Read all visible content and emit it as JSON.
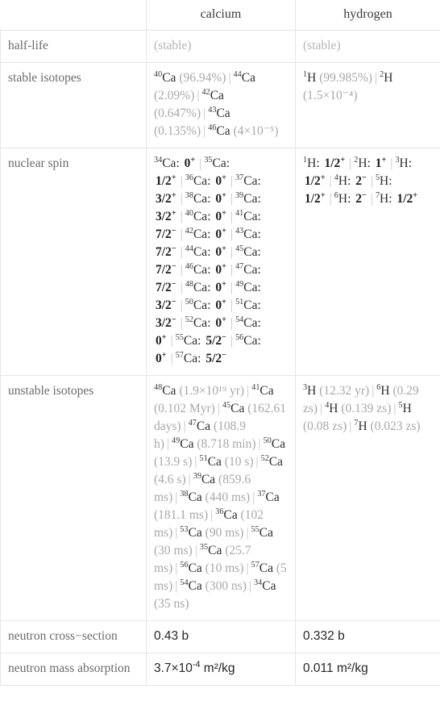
{
  "header": {
    "corner": "",
    "columns": [
      "calcium",
      "hydrogen"
    ]
  },
  "rows": {
    "half_life": {
      "label": "half-life",
      "calcium": "(stable)",
      "hydrogen": "(stable)"
    },
    "stable_isotopes": {
      "label": "stable isotopes",
      "calcium": "40Ca (96.94%) | 44Ca (2.09%) | 42Ca (0.647%) | 43Ca (0.135%) | 46Ca (4×10^-5)",
      "hydrogen": "1H (99.985%) | 2H (1.5×10^-4)",
      "calcium_items": [
        {
          "mass": "40",
          "symbol": "Ca",
          "value": "(96.94%)"
        },
        {
          "mass": "44",
          "symbol": "Ca",
          "value": "(2.09%)"
        },
        {
          "mass": "42",
          "symbol": "Ca",
          "value": "(0.647%)"
        },
        {
          "mass": "43",
          "symbol": "Ca",
          "value": "(0.135%)"
        },
        {
          "mass": "46",
          "symbol": "Ca",
          "value": "(4×10⁻⁵)"
        }
      ],
      "hydrogen_items": [
        {
          "mass": "1",
          "symbol": "H",
          "value": "(99.985%)"
        },
        {
          "mass": "2",
          "symbol": "H",
          "value": "(1.5×10⁻⁴)"
        }
      ]
    },
    "nuclear_spin": {
      "label": "nuclear spin",
      "calcium_items": [
        {
          "mass": "34",
          "symbol": "Ca",
          "spin": "0+"
        },
        {
          "mass": "35",
          "symbol": "Ca",
          "spin": "1/2+"
        },
        {
          "mass": "36",
          "symbol": "Ca",
          "spin": "0+"
        },
        {
          "mass": "37",
          "symbol": "Ca",
          "spin": "3/2+"
        },
        {
          "mass": "38",
          "symbol": "Ca",
          "spin": "0+"
        },
        {
          "mass": "39",
          "symbol": "Ca",
          "spin": "3/2+"
        },
        {
          "mass": "40",
          "symbol": "Ca",
          "spin": "0+"
        },
        {
          "mass": "41",
          "symbol": "Ca",
          "spin": "7/2-"
        },
        {
          "mass": "42",
          "symbol": "Ca",
          "spin": "0+"
        },
        {
          "mass": "43",
          "symbol": "Ca",
          "spin": "7/2-"
        },
        {
          "mass": "44",
          "symbol": "Ca",
          "spin": "0+"
        },
        {
          "mass": "45",
          "symbol": "Ca",
          "spin": "7/2-"
        },
        {
          "mass": "46",
          "symbol": "Ca",
          "spin": "0+"
        },
        {
          "mass": "47",
          "symbol": "Ca",
          "spin": "7/2-"
        },
        {
          "mass": "48",
          "symbol": "Ca",
          "spin": "0+"
        },
        {
          "mass": "49",
          "symbol": "Ca",
          "spin": "3/2-"
        },
        {
          "mass": "50",
          "symbol": "Ca",
          "spin": "0+"
        },
        {
          "mass": "51",
          "symbol": "Ca",
          "spin": "3/2-"
        },
        {
          "mass": "52",
          "symbol": "Ca",
          "spin": "0+"
        },
        {
          "mass": "54",
          "symbol": "Ca",
          "spin": "0+"
        },
        {
          "mass": "55",
          "symbol": "Ca",
          "spin": "5/2-"
        },
        {
          "mass": "56",
          "symbol": "Ca",
          "spin": "0+"
        },
        {
          "mass": "57",
          "symbol": "Ca",
          "spin": "5/2-"
        }
      ],
      "hydrogen_items": [
        {
          "mass": "1",
          "symbol": "H",
          "spin": "1/2+"
        },
        {
          "mass": "2",
          "symbol": "H",
          "spin": "1+"
        },
        {
          "mass": "3",
          "symbol": "H",
          "spin": "1/2+"
        },
        {
          "mass": "4",
          "symbol": "H",
          "spin": "2-"
        },
        {
          "mass": "5",
          "symbol": "H",
          "spin": "1/2+"
        },
        {
          "mass": "6",
          "symbol": "H",
          "spin": "2-"
        },
        {
          "mass": "7",
          "symbol": "H",
          "spin": "1/2+"
        }
      ]
    },
    "unstable_isotopes": {
      "label": "unstable isotopes",
      "calcium_items": [
        {
          "mass": "48",
          "symbol": "Ca",
          "value": "(1.9×10¹⁹ yr)"
        },
        {
          "mass": "41",
          "symbol": "Ca",
          "value": "(0.102 Myr)"
        },
        {
          "mass": "45",
          "symbol": "Ca",
          "value": "(162.61 days)"
        },
        {
          "mass": "47",
          "symbol": "Ca",
          "value": "(108.9 h)"
        },
        {
          "mass": "49",
          "symbol": "Ca",
          "value": "(8.718 min)"
        },
        {
          "mass": "50",
          "symbol": "Ca",
          "value": "(13.9 s)"
        },
        {
          "mass": "51",
          "symbol": "Ca",
          "value": "(10 s)"
        },
        {
          "mass": "52",
          "symbol": "Ca",
          "value": "(4.6 s)"
        },
        {
          "mass": "39",
          "symbol": "Ca",
          "value": "(859.6 ms)"
        },
        {
          "mass": "38",
          "symbol": "Ca",
          "value": "(440 ms)"
        },
        {
          "mass": "37",
          "symbol": "Ca",
          "value": "(181.1 ms)"
        },
        {
          "mass": "36",
          "symbol": "Ca",
          "value": "(102 ms)"
        },
        {
          "mass": "53",
          "symbol": "Ca",
          "value": "(90 ms)"
        },
        {
          "mass": "55",
          "symbol": "Ca",
          "value": "(30 ms)"
        },
        {
          "mass": "35",
          "symbol": "Ca",
          "value": "(25.7 ms)"
        },
        {
          "mass": "56",
          "symbol": "Ca",
          "value": "(10 ms)"
        },
        {
          "mass": "57",
          "symbol": "Ca",
          "value": "(5 ms)"
        },
        {
          "mass": "54",
          "symbol": "Ca",
          "value": "(300 ns)"
        },
        {
          "mass": "34",
          "symbol": "Ca",
          "value": "(35 ns)"
        }
      ],
      "hydrogen_items": [
        {
          "mass": "3",
          "symbol": "H",
          "value": "(12.32 yr)"
        },
        {
          "mass": "6",
          "symbol": "H",
          "value": "(0.29 zs)"
        },
        {
          "mass": "4",
          "symbol": "H",
          "value": "(0.139 zs)"
        },
        {
          "mass": "5",
          "symbol": "H",
          "value": "(0.08 zs)"
        },
        {
          "mass": "7",
          "symbol": "H",
          "value": "(0.023 zs)"
        }
      ]
    },
    "neutron_cross_section": {
      "label": "neutron cross−section",
      "calcium": "0.43 b",
      "hydrogen": "0.332 b"
    },
    "neutron_mass_absorption": {
      "label": "neutron mass absorption",
      "calcium_prefix": "3.7×10",
      "calcium_exp": "-4",
      "calcium_unit": " m²/kg",
      "hydrogen": "0.011 m²/kg"
    }
  }
}
